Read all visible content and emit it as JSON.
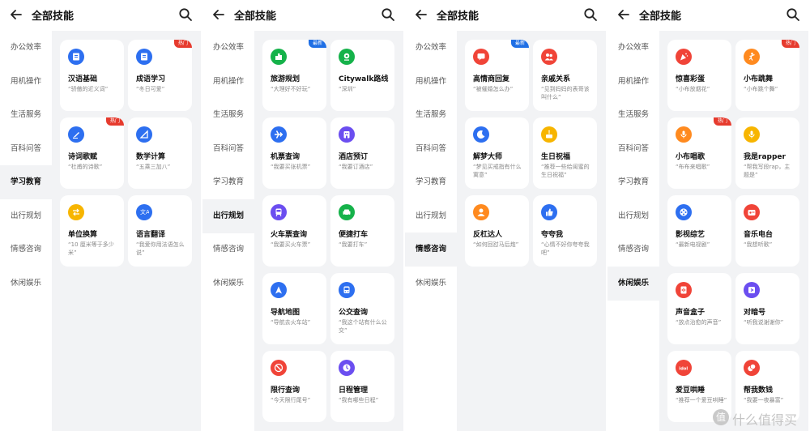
{
  "app_title": "全部技能",
  "categories": [
    "办公效率",
    "用机操作",
    "生活服务",
    "百科问答",
    "学习教育",
    "出行规划",
    "情感咨询",
    "休闲娱乐"
  ],
  "watermark": "什么值得买",
  "watermark_logo": "值",
  "badges": {
    "hot": "热门",
    "new": "最新"
  },
  "colors": {
    "blue": "#2d6ff0",
    "green": "#15b24a",
    "red": "#f04438",
    "orange": "#ff8a1f",
    "yellow": "#f7b500",
    "purple": "#6b4ef0",
    "hot": "#e63b2e",
    "new": "#1f6fe5",
    "panel_bg": "#f2f3f5"
  },
  "screens": [
    {
      "active_category": "学习教育",
      "cards": [
        {
          "name": "汉语基础",
          "desc": "“骄傲的近义词”",
          "icon": "book-icon",
          "color": "#2d6ff0"
        },
        {
          "name": "成语学习",
          "desc": "“冬日可爱”",
          "icon": "book-icon",
          "color": "#2d6ff0",
          "badge": "热门"
        },
        {
          "name": "诗词歌赋",
          "desc": "“杜甫的诗歌”",
          "icon": "pen-icon",
          "color": "#2d6ff0",
          "badge": "热门"
        },
        {
          "name": "数学计算",
          "desc": "“五乘三加八”",
          "icon": "ruler-icon",
          "color": "#2d6ff0"
        },
        {
          "name": "单位换算",
          "desc": "“10 厘米等于多少米”",
          "icon": "convert-icon",
          "color": "#f7b500"
        },
        {
          "name": "语言翻译",
          "desc": "“我爱你用法语怎么说”",
          "icon": "translate-icon",
          "color": "#2d6ff0"
        }
      ]
    },
    {
      "active_category": "出行规划",
      "cards": [
        {
          "name": "旅游规划",
          "desc": "“大理好不好玩”",
          "icon": "building-icon",
          "color": "#15b24a",
          "badge": "最新"
        },
        {
          "name": "Citywalk路线",
          "desc": "“深圳”",
          "icon": "pin-icon",
          "color": "#15b24a"
        },
        {
          "name": "机票查询",
          "desc": "“我要买张机票”",
          "icon": "plane-icon",
          "color": "#2d6ff0"
        },
        {
          "name": "酒店预订",
          "desc": "“我要订酒店”",
          "icon": "hotel-icon",
          "color": "#6b4ef0"
        },
        {
          "name": "火车票查询",
          "desc": "“我要买火车票”",
          "icon": "train-icon",
          "color": "#6b4ef0"
        },
        {
          "name": "便捷打车",
          "desc": "“我要打车”",
          "icon": "car-icon",
          "color": "#15b24a"
        },
        {
          "name": "导航地图",
          "desc": "“导航去火车站”",
          "icon": "navigation-icon",
          "color": "#2d6ff0"
        },
        {
          "name": "公交查询",
          "desc": "“我这个站有什么公交”",
          "icon": "bus-icon",
          "color": "#2d6ff0"
        },
        {
          "name": "限行查询",
          "desc": "“今天限行尾号”",
          "icon": "restriction-icon",
          "color": "#f04438"
        },
        {
          "name": "日程管理",
          "desc": "“我有哪些日程”",
          "icon": "clock-icon",
          "color": "#6b4ef0"
        }
      ]
    },
    {
      "active_category": "情感咨询",
      "cards": [
        {
          "name": "高情商回复",
          "desc": "“被催婚怎么办”",
          "icon": "chat-icon",
          "color": "#f04438",
          "badge": "最新"
        },
        {
          "name": "亲戚关系",
          "desc": "“见到妈妈的表哥该叫什么”",
          "icon": "people-icon",
          "color": "#f04438"
        },
        {
          "name": "解梦大师",
          "desc": "“梦见买戒指有什么寓意”",
          "icon": "moon-icon",
          "color": "#2d6ff0"
        },
        {
          "name": "生日祝福",
          "desc": "“推荐一些给闺蜜的生日祝福”",
          "icon": "cake-icon",
          "color": "#f7b500"
        },
        {
          "name": "反杠达人",
          "desc": "“如何回怼马后炮”",
          "icon": "user-icon",
          "color": "#ff8a1f"
        },
        {
          "name": "夸夸我",
          "desc": "“心情不好你夸夸我吧”",
          "icon": "thumbs-up-icon",
          "color": "#2d6ff0"
        }
      ]
    },
    {
      "active_category": "休闲娱乐",
      "cards": [
        {
          "name": "惊喜彩蛋",
          "desc": "“小布放烟花”",
          "icon": "party-icon",
          "color": "#f04438"
        },
        {
          "name": "小布跳舞",
          "desc": "“小布跳个舞”",
          "icon": "dance-icon",
          "color": "#ff8a1f",
          "badge": "热门"
        },
        {
          "name": "小布唱歌",
          "desc": "“布布来唱歌”",
          "icon": "microphone-icon",
          "color": "#ff8a1f",
          "badge": "热门"
        },
        {
          "name": "我是rapper",
          "desc": "“帮我写段rap，主题是”",
          "icon": "microphone-icon",
          "color": "#f7b500"
        },
        {
          "name": "影视综艺",
          "desc": "“最新电视剧”",
          "icon": "film-icon",
          "color": "#2d6ff0"
        },
        {
          "name": "音乐电台",
          "desc": "“我想听歌”",
          "icon": "radio-icon",
          "color": "#f04438"
        },
        {
          "name": "声音盒子",
          "desc": "“放点治愈的声音”",
          "icon": "sound-box-icon",
          "color": "#f04438"
        },
        {
          "name": "对暗号",
          "desc": "“听我说谢谢你”",
          "icon": "code-icon",
          "color": "#6b4ef0"
        },
        {
          "name": "爱豆哄睡",
          "desc": "“推荐一个爱豆哄睡”",
          "icon": "idol-icon",
          "color": "#f04438"
        },
        {
          "name": "帮我数钱",
          "desc": "“我要一夜暴富”",
          "icon": "coin-icon",
          "color": "#f04438"
        }
      ]
    }
  ]
}
